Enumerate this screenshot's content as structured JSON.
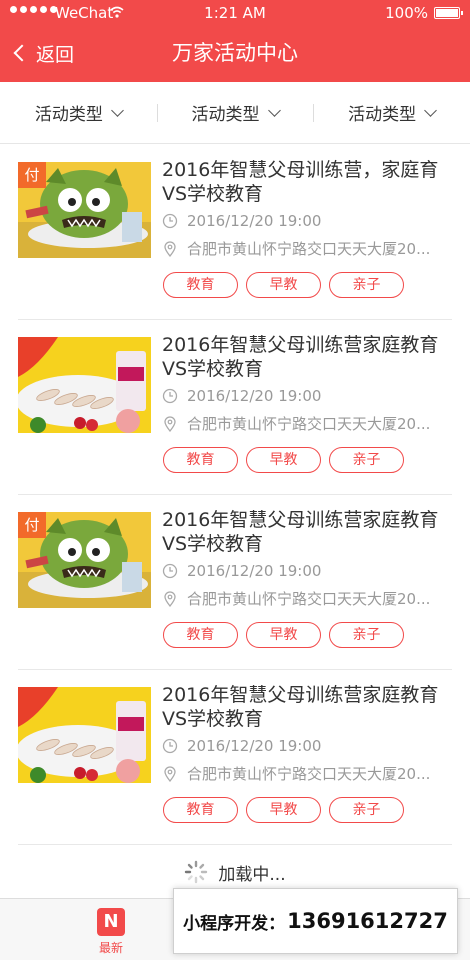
{
  "status_bar": {
    "carrier": "WeChat",
    "time": "1:21 AM",
    "battery": "100%"
  },
  "nav": {
    "back_label": "返回",
    "title": "万家活动中心"
  },
  "filters": [
    {
      "label": "活动类型"
    },
    {
      "label": "活动类型"
    },
    {
      "label": "活动类型"
    }
  ],
  "events": [
    {
      "title": "2016年智慧父母训练营，家庭育VS学校教育",
      "datetime": "2016/12/20 19:00",
      "location": "合肥市黄山怀宁路交口天天大厦20...",
      "badge": "付",
      "image": "cartoon-monster",
      "tags": [
        "教育",
        "早教",
        "亲子"
      ]
    },
    {
      "title": "2016年智慧父母训练营家庭教育VS学校教育",
      "datetime": "2016/12/20 19:00",
      "location": "合肥市黄山怀宁路交口天天大厦20...",
      "badge": "",
      "image": "shrimp-dish",
      "tags": [
        "教育",
        "早教",
        "亲子"
      ]
    },
    {
      "title": "2016年智慧父母训练营家庭教育VS学校教育",
      "datetime": "2016/12/20 19:00",
      "location": "合肥市黄山怀宁路交口天天大厦20...",
      "badge": "付",
      "image": "cartoon-monster",
      "tags": [
        "教育",
        "早教",
        "亲子"
      ]
    },
    {
      "title": "2016年智慧父母训练营家庭教育VS学校教育",
      "datetime": "2016/12/20 19:00",
      "location": "合肥市黄山怀宁路交口天天大厦20...",
      "badge": "",
      "image": "shrimp-dish",
      "tags": [
        "教育",
        "早教",
        "亲子"
      ]
    }
  ],
  "loading_text": "加载中...",
  "tabbar": {
    "latest_icon_letter": "N",
    "latest_label": "最新"
  },
  "contact": {
    "label": "小程序开发：",
    "number": "13691612727"
  },
  "colors": {
    "accent": "#f24a4a",
    "badge": "#f26a2a",
    "meta_text": "#999999"
  }
}
